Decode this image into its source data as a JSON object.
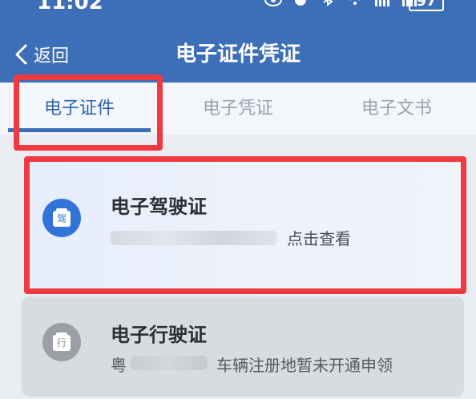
{
  "status": {
    "time": "11:02",
    "battery": "97"
  },
  "nav": {
    "back_label": "返回",
    "title": "电子证件凭证"
  },
  "tabs": [
    {
      "label": "电子证件",
      "active": true
    },
    {
      "label": "电子凭证",
      "active": false
    },
    {
      "label": "电子文书",
      "active": false
    }
  ],
  "cards": [
    {
      "title": "电子驾驶证",
      "icon_char": "驾",
      "action": "点击查看",
      "icon_color": "#2f74d6"
    },
    {
      "title": "电子行驶证",
      "icon_char": "行",
      "prefix": "粤",
      "note": "车辆注册地暂未开通申领",
      "icon_color": "#9c9fa5"
    }
  ],
  "colors": {
    "header": "#3d6fb8",
    "highlight": "#ee3a40",
    "active_tab": "#2e64ab"
  }
}
